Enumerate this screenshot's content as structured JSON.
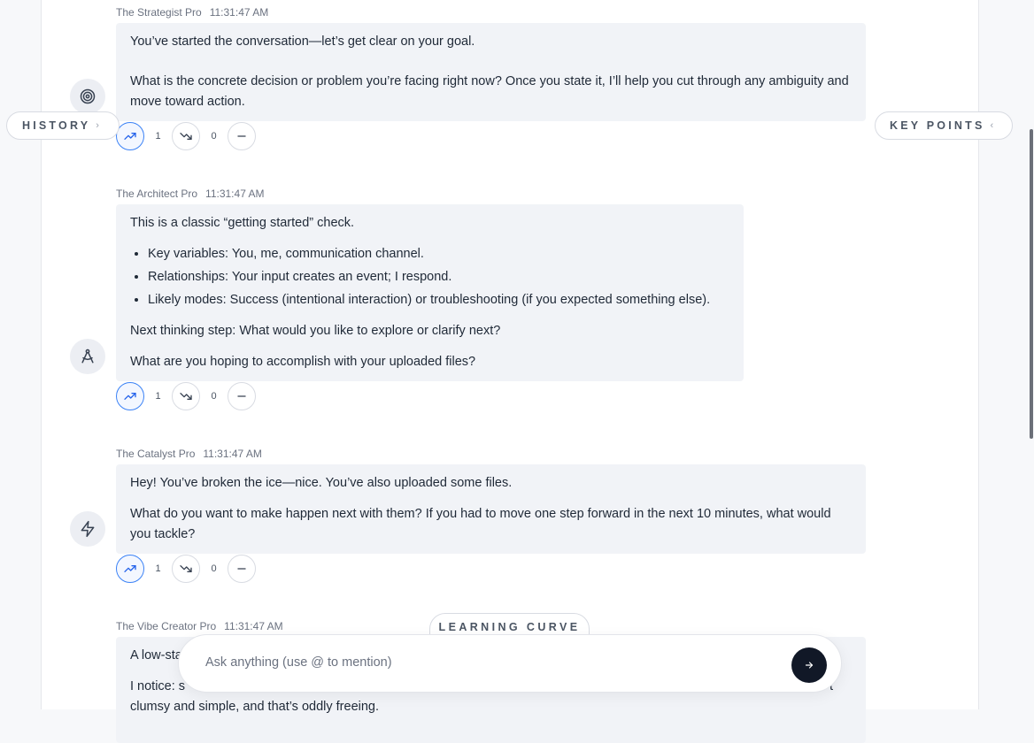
{
  "messages": [
    {
      "author": "The Strategist Pro",
      "time": "11:31:47 AM",
      "icon": "target-icon",
      "paragraphs": [
        "You’ve started the conversation—let’s get clear on your goal.",
        "What is the concrete decision or problem you’re facing right now? Once you state it, I’ll help you cut through any ambiguity and move toward action."
      ],
      "up_count": "1",
      "down_count": "0"
    },
    {
      "author": "The Architect Pro",
      "time": "11:31:47 AM",
      "icon": "compass-icon",
      "intro": "This is a classic “getting started” check.",
      "bullets": [
        "Key variables: You, me, communication channel.",
        "Relationships: Your input creates an event; I respond.",
        "Likely modes: Success (intentional interaction) or troubleshooting (if you expected something else)."
      ],
      "paragraphs": [
        "Next thinking step: What would you like to explore or clarify next?",
        "What are you hoping to accomplish with your uploaded files?"
      ],
      "up_count": "1",
      "down_count": "0"
    },
    {
      "author": "The Catalyst Pro",
      "time": "11:31:47 AM",
      "icon": "lightning-icon",
      "paragraphs": [
        "Hey! You’ve broken the ice—nice. You’ve also uploaded some files.",
        "What do you want to make happen next with them? If you had to move one step forward in the next 10 minutes, what would you tackle?"
      ],
      "up_count": "1",
      "down_count": "0"
    },
    {
      "author": "The Vibe Creator Pro",
      "time": "11:31:47 AM",
      "line1": "A low-sta",
      "line2_start": "I notice: s",
      "line2_end": "t",
      "line3": "clumsy and simple, and that’s oddly freeing."
    }
  ],
  "history_label": "HISTORY",
  "key_points_label": "KEY POINTS",
  "learning_curve_label": "LEARNING CURVE",
  "composer": {
    "placeholder": "Ask anything (use @ to mention)"
  },
  "colors": {
    "accent": "#3b82f6",
    "bubble": "#f1f3f7",
    "send": "#111827"
  }
}
